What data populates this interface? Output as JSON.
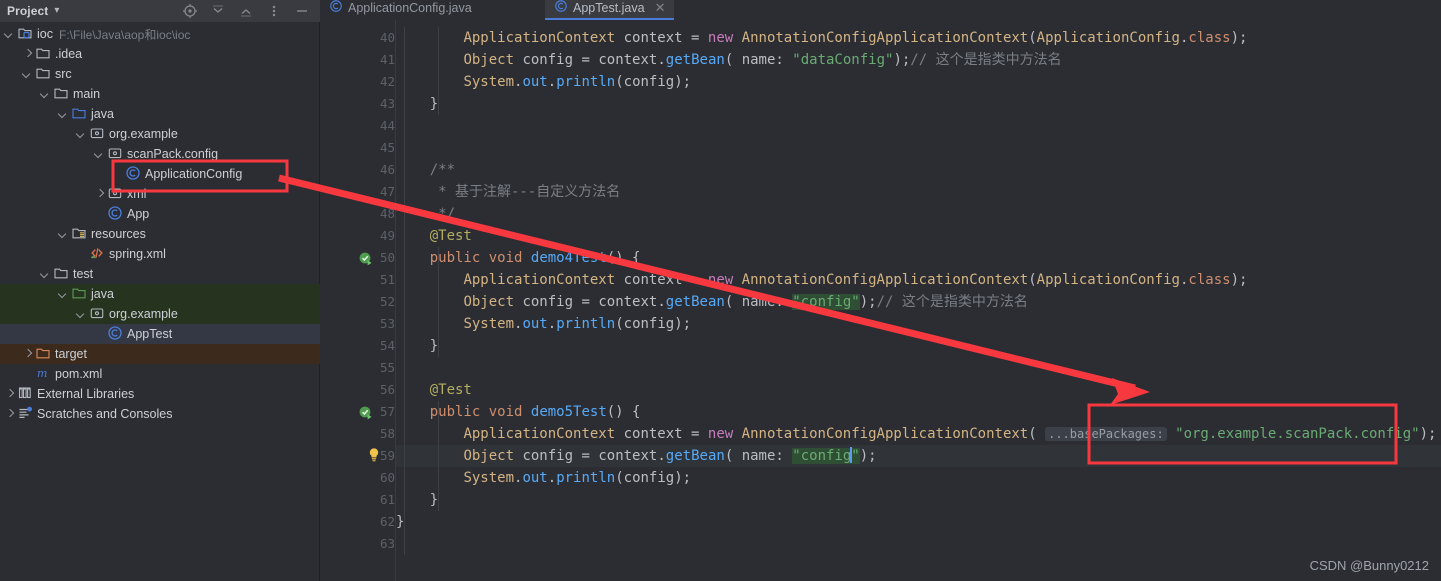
{
  "panel": {
    "title": "Project",
    "chevron_icon": "chevron-down-icon",
    "tools": [
      {
        "name": "locate-icon",
        "label": "Select Opened File"
      },
      {
        "name": "expand-all-icon",
        "label": "Expand All"
      },
      {
        "name": "collapse-all-icon",
        "label": "Collapse All"
      },
      {
        "name": "more-options-icon",
        "label": "Options"
      },
      {
        "name": "minimize-icon",
        "label": "Hide"
      }
    ]
  },
  "tree": [
    {
      "indent": 0,
      "arrow": "open",
      "icon": "module-icon",
      "label": "ioc",
      "path": "F:\\File\\Java\\aop和ioc\\ioc",
      "bg": "none"
    },
    {
      "indent": 1,
      "arrow": "closed",
      "icon": "folder-icon",
      "label": ".idea",
      "path": "",
      "bg": "none"
    },
    {
      "indent": 1,
      "arrow": "open",
      "icon": "folder-icon",
      "label": "src",
      "path": "",
      "bg": "none"
    },
    {
      "indent": 2,
      "arrow": "open",
      "icon": "folder-icon",
      "label": "main",
      "path": "",
      "bg": "none"
    },
    {
      "indent": 3,
      "arrow": "open",
      "icon": "source-root-icon",
      "label": "java",
      "path": "",
      "bg": "none"
    },
    {
      "indent": 4,
      "arrow": "open",
      "icon": "package-icon",
      "label": "org.example",
      "path": "",
      "bg": "none"
    },
    {
      "indent": 5,
      "arrow": "open",
      "icon": "package-icon",
      "label": "scanPack.config",
      "path": "",
      "bg": "none"
    },
    {
      "indent": 6,
      "arrow": "none",
      "icon": "java-class-icon",
      "label": "ApplicationConfig",
      "path": "",
      "bg": "none"
    },
    {
      "indent": 5,
      "arrow": "closed",
      "icon": "package-icon",
      "label": "xml",
      "path": "",
      "bg": "none"
    },
    {
      "indent": 5,
      "arrow": "none",
      "icon": "java-class-icon",
      "label": "App",
      "path": "",
      "bg": "none"
    },
    {
      "indent": 3,
      "arrow": "open",
      "icon": "resource-root-icon",
      "label": "resources",
      "path": "",
      "bg": "none"
    },
    {
      "indent": 4,
      "arrow": "none",
      "icon": "xml-file-icon",
      "label": "spring.xml",
      "path": "",
      "bg": "none"
    },
    {
      "indent": 2,
      "arrow": "open",
      "icon": "folder-icon",
      "label": "test",
      "path": "",
      "bg": "none"
    },
    {
      "indent": 3,
      "arrow": "open",
      "icon": "test-source-root-icon",
      "label": "java",
      "path": "",
      "bg": "green"
    },
    {
      "indent": 4,
      "arrow": "open",
      "icon": "package-icon",
      "label": "org.example",
      "path": "",
      "bg": "green"
    },
    {
      "indent": 5,
      "arrow": "none",
      "icon": "java-class-icon",
      "label": "AppTest",
      "path": "",
      "bg": "selected"
    },
    {
      "indent": 1,
      "arrow": "closed",
      "icon": "excluded-folder-icon",
      "label": "target",
      "path": "",
      "bg": "brown"
    },
    {
      "indent": 1,
      "arrow": "none",
      "icon": "maven-icon",
      "label": "pom.xml",
      "path": "",
      "bg": "none"
    },
    {
      "indent": 0,
      "arrow": "closed",
      "icon": "libraries-icon",
      "label": "External Libraries",
      "path": "",
      "bg": "none"
    },
    {
      "indent": 0,
      "arrow": "closed",
      "icon": "scratches-icon",
      "label": "Scratches and Consoles",
      "path": "",
      "bg": "none"
    }
  ],
  "tabs": [
    {
      "label": "ApplicationConfig.java",
      "icon": "java-class-icon",
      "active": false,
      "closable": false
    },
    {
      "label": "AppTest.java",
      "icon": "java-class-icon",
      "active": true,
      "closable": true
    }
  ],
  "editor": {
    "first_line": 40,
    "last_line": 63,
    "highlighted_line": 59,
    "gutter_marks": [
      {
        "line": 50,
        "icon": "run-test-gutter-icon"
      },
      {
        "line": 57,
        "icon": "run-test-gutter-icon"
      },
      {
        "line": 59,
        "icon": "intention-bulb-icon"
      }
    ],
    "lines": [
      {
        "n": 40,
        "text": "        ApplicationContext context = new AnnotationConfigApplicationContext(ApplicationConfig.class);"
      },
      {
        "n": 41,
        "text": "        Object config = context.getBean( name: \"dataConfig\");// 这个是指类中方法名"
      },
      {
        "n": 42,
        "text": "        System.out.println(config);"
      },
      {
        "n": 43,
        "text": "    }"
      },
      {
        "n": 44,
        "text": ""
      },
      {
        "n": 45,
        "text": ""
      },
      {
        "n": 46,
        "text": "    /**"
      },
      {
        "n": 47,
        "text": "     * 基于注解---自定义方法名"
      },
      {
        "n": 48,
        "text": "     */"
      },
      {
        "n": 49,
        "text": "    @Test"
      },
      {
        "n": 50,
        "text": "    public void demo4Test() {"
      },
      {
        "n": 51,
        "text": "        ApplicationContext context = new AnnotationConfigApplicationContext(ApplicationConfig.class);"
      },
      {
        "n": 52,
        "text": "        Object config = context.getBean( name: \"config\");// 这个是指类中方法名"
      },
      {
        "n": 53,
        "text": "        System.out.println(config);"
      },
      {
        "n": 54,
        "text": "    }"
      },
      {
        "n": 55,
        "text": ""
      },
      {
        "n": 56,
        "text": "    @Test"
      },
      {
        "n": 57,
        "text": "    public void demo5Test() {"
      },
      {
        "n": 58,
        "text": "        ApplicationContext context = new AnnotationConfigApplicationContext( ...basePackages: \"org.example.scanPack.config\");"
      },
      {
        "n": 59,
        "text": "        Object config = context.getBean( name: \"config\");"
      },
      {
        "n": 60,
        "text": "        System.out.println(config);"
      },
      {
        "n": 61,
        "text": "    }"
      },
      {
        "n": 62,
        "text": "}"
      },
      {
        "n": 63,
        "text": ""
      }
    ],
    "parameter_hints": [
      "name:",
      "...basePackages:"
    ]
  },
  "annotations": {
    "highlight_color": "#f8383f",
    "boxes": [
      {
        "name": "application-config-tree-highlight",
        "target": "ApplicationConfig"
      },
      {
        "name": "base-packages-code-highlight",
        "target": "\"org.example.scanPack.config\""
      }
    ],
    "arrow": {
      "from": "ApplicationConfig tree node",
      "to": "basePackages string literal"
    }
  },
  "watermark": "CSDN @Bunny0212"
}
